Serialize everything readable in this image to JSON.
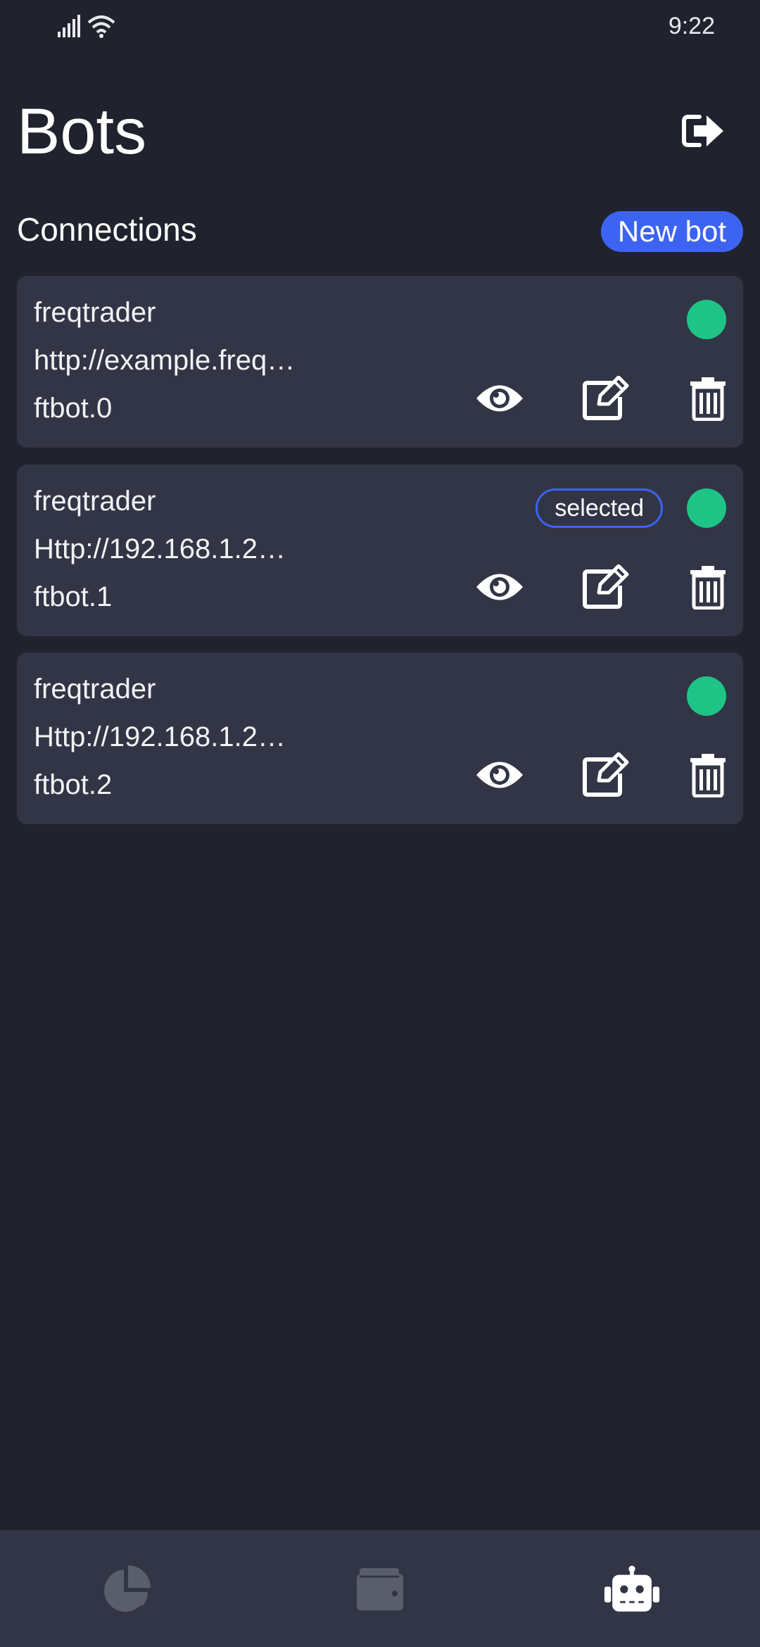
{
  "status_bar": {
    "time": "9:22"
  },
  "header": {
    "title": "Bots",
    "logout_icon": "logout-arrow-icon"
  },
  "connections": {
    "title": "Connections",
    "new_bot_label": "New bot"
  },
  "bots": [
    {
      "name": "freqtrader",
      "url": "http://example.freq…",
      "id": "ftbot.0",
      "status_color": "#1ec486",
      "selected": false
    },
    {
      "name": "freqtrader",
      "url": "Http://192.168.1.2…",
      "id": "ftbot.1",
      "status_color": "#1ec486",
      "selected": true,
      "badge": "selected"
    },
    {
      "name": "freqtrader",
      "url": "Http://192.168.1.2…",
      "id": "ftbot.2",
      "status_color": "#1ec486",
      "selected": false
    }
  ],
  "bottom_nav": {
    "items": [
      "pie-chart-icon",
      "wallet-icon",
      "robot-icon"
    ],
    "active": "robot-icon"
  },
  "colors": {
    "background": "#20222d",
    "card": "#323545",
    "accent": "#3d63f2",
    "online": "#1ec486"
  }
}
